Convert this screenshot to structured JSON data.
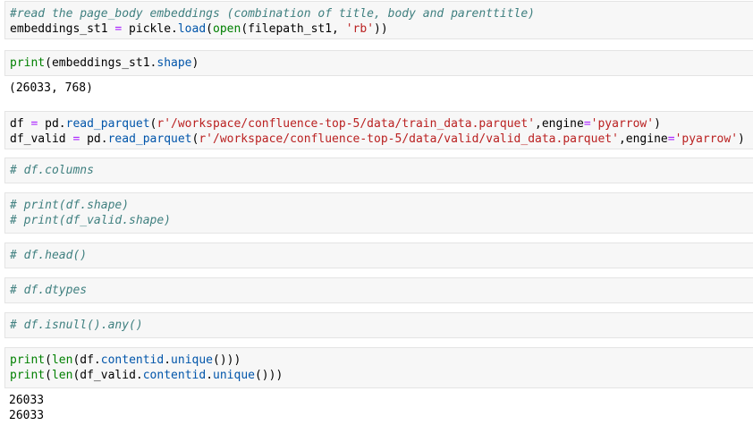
{
  "cells": [
    {
      "type": "code",
      "lines": [
        [
          {
            "t": "#read the page_body embeddings (combination of title, body and parenttitle)",
            "c": "cm"
          }
        ],
        [
          {
            "t": "embeddings_st1 ",
            "c": "nm"
          },
          {
            "t": "=",
            "c": "op"
          },
          {
            "t": " pickle.",
            "c": "nm"
          },
          {
            "t": "load",
            "c": "fn"
          },
          {
            "t": "(",
            "c": "nm"
          },
          {
            "t": "open",
            "c": "kw"
          },
          {
            "t": "(filepath_st1, ",
            "c": "nm"
          },
          {
            "t": "'rb'",
            "c": "st"
          },
          {
            "t": "))",
            "c": "nm"
          }
        ]
      ]
    },
    {
      "type": "code",
      "lines": [
        [
          {
            "t": "print",
            "c": "kw"
          },
          {
            "t": "(embeddings_st1.",
            "c": "nm"
          },
          {
            "t": "shape",
            "c": "fn"
          },
          {
            "t": ")",
            "c": "nm"
          }
        ]
      ]
    },
    {
      "type": "output",
      "lines": [
        [
          {
            "t": "(26033, 768)",
            "c": "nm"
          }
        ]
      ]
    },
    {
      "type": "code",
      "lines": [
        [
          {
            "t": "df ",
            "c": "nm"
          },
          {
            "t": "=",
            "c": "op"
          },
          {
            "t": " pd.",
            "c": "nm"
          },
          {
            "t": "read_parquet",
            "c": "fn"
          },
          {
            "t": "(",
            "c": "nm"
          },
          {
            "t": "r'/workspace/confluence-top-5/data/train_data.parquet'",
            "c": "st"
          },
          {
            "t": ",engine",
            "c": "nm"
          },
          {
            "t": "=",
            "c": "op"
          },
          {
            "t": "'pyarrow'",
            "c": "st"
          },
          {
            "t": ")",
            "c": "nm"
          }
        ],
        [
          {
            "t": "df_valid ",
            "c": "nm"
          },
          {
            "t": "=",
            "c": "op"
          },
          {
            "t": " pd.",
            "c": "nm"
          },
          {
            "t": "read_parquet",
            "c": "fn"
          },
          {
            "t": "(",
            "c": "nm"
          },
          {
            "t": "r'/workspace/confluence-top-5/data/valid/valid_data.parquet'",
            "c": "st"
          },
          {
            "t": ",engine",
            "c": "nm"
          },
          {
            "t": "=",
            "c": "op"
          },
          {
            "t": "'pyarrow'",
            "c": "st"
          },
          {
            "t": ")",
            "c": "nm"
          }
        ]
      ]
    },
    {
      "type": "code",
      "lines": [
        [
          {
            "t": "# df.columns",
            "c": "cm"
          }
        ]
      ]
    },
    {
      "type": "code",
      "lines": [
        [
          {
            "t": "# print(df.shape)",
            "c": "cm"
          }
        ],
        [
          {
            "t": "# print(df_valid.shape)",
            "c": "cm"
          }
        ]
      ]
    },
    {
      "type": "code",
      "lines": [
        [
          {
            "t": "# df.head()",
            "c": "cm"
          }
        ]
      ]
    },
    {
      "type": "code",
      "lines": [
        [
          {
            "t": "# df.dtypes",
            "c": "cm"
          }
        ]
      ]
    },
    {
      "type": "code",
      "lines": [
        [
          {
            "t": "# df.isnull().any()",
            "c": "cm"
          }
        ]
      ]
    },
    {
      "type": "code",
      "lines": [
        [
          {
            "t": "print",
            "c": "kw"
          },
          {
            "t": "(",
            "c": "nm"
          },
          {
            "t": "len",
            "c": "kw"
          },
          {
            "t": "(df.",
            "c": "nm"
          },
          {
            "t": "contentid",
            "c": "fn"
          },
          {
            "t": ".",
            "c": "nm"
          },
          {
            "t": "unique",
            "c": "fn"
          },
          {
            "t": "()))",
            "c": "nm"
          }
        ],
        [
          {
            "t": "print",
            "c": "kw"
          },
          {
            "t": "(",
            "c": "nm"
          },
          {
            "t": "len",
            "c": "kw"
          },
          {
            "t": "(df_valid.",
            "c": "nm"
          },
          {
            "t": "contentid",
            "c": "fn"
          },
          {
            "t": ".",
            "c": "nm"
          },
          {
            "t": "unique",
            "c": "fn"
          },
          {
            "t": "()))",
            "c": "nm"
          }
        ]
      ]
    },
    {
      "type": "output",
      "lines": [
        [
          {
            "t": "26033",
            "c": "nm"
          }
        ],
        [
          {
            "t": "26033",
            "c": "nm"
          }
        ]
      ]
    }
  ]
}
